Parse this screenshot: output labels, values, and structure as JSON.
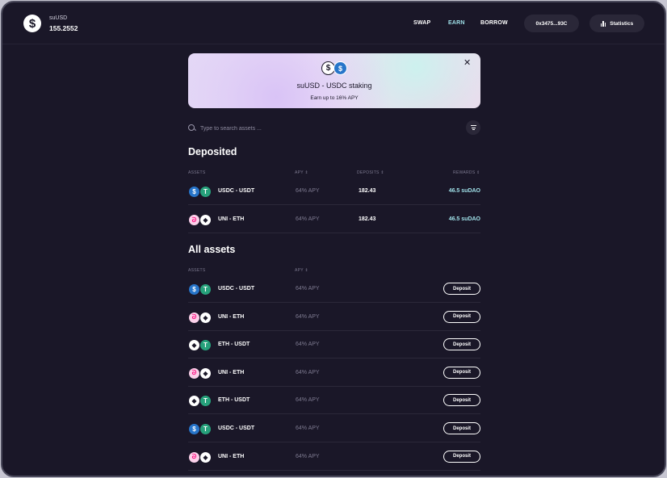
{
  "header": {
    "balance_label": "suUSD",
    "balance_value": "155.2552",
    "nav": [
      "SWAP",
      "EARN",
      "BORROW"
    ],
    "active_nav": "EARN",
    "wallet_address": "0x3475...93C",
    "statistics_label": "Statistics"
  },
  "banner": {
    "title": "suUSD - USDC staking",
    "subtitle": "Earn up to 16% APY",
    "close": "✕"
  },
  "search": {
    "placeholder": "Type to search assets ..."
  },
  "deposited": {
    "title": "Deposited",
    "columns": [
      "ASSETS",
      "APY ⇕",
      "DEPOSITS ⇕",
      "REWARDS ⇕"
    ],
    "rows": [
      {
        "icons": [
          "usdc",
          "usdt"
        ],
        "pair": "USDC - USDT",
        "apy": "64% APY",
        "deposits": "182.43",
        "rewards": "46.5 suDAO"
      },
      {
        "icons": [
          "uni",
          "eth"
        ],
        "pair": "UNI - ETH",
        "apy": "64% APY",
        "deposits": "182.43",
        "rewards": "46.5 suDAO"
      }
    ]
  },
  "all_assets": {
    "title": "All  assets",
    "columns": [
      "ASSETS",
      "APY ⇕"
    ],
    "deposit_label": "Deposit",
    "rows": [
      {
        "icons": [
          "usdc",
          "usdt"
        ],
        "pair": "USDC - USDT",
        "apy": "64% APY"
      },
      {
        "icons": [
          "uni",
          "eth"
        ],
        "pair": "UNI - ETH",
        "apy": "64% APY"
      },
      {
        "icons": [
          "eth",
          "usdt"
        ],
        "pair": "ETH - USDT",
        "apy": "64% APY"
      },
      {
        "icons": [
          "uni",
          "eth"
        ],
        "pair": "UNI - ETH",
        "apy": "64% APY"
      },
      {
        "icons": [
          "eth",
          "usdt"
        ],
        "pair": "ETH - USDT",
        "apy": "64% APY"
      },
      {
        "icons": [
          "usdc",
          "usdt"
        ],
        "pair": "USDC - USDT",
        "apy": "64% APY"
      },
      {
        "icons": [
          "uni",
          "eth"
        ],
        "pair": "UNI - ETH",
        "apy": "64% APY"
      }
    ]
  },
  "colors": {
    "background": "#1a1728",
    "accent": "#9fe0e8",
    "usdc": "#2775ca",
    "usdt": "#26a17b",
    "uni": "#ff007a"
  }
}
